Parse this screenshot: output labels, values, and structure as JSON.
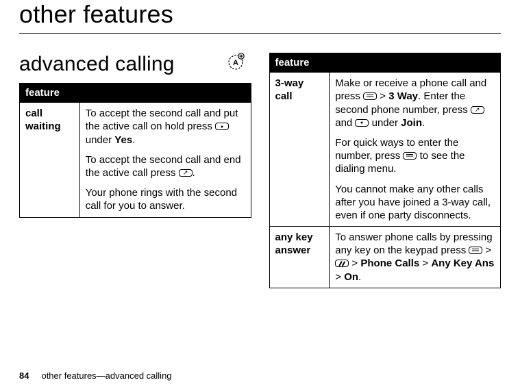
{
  "title": "other features",
  "section_title": "advanced calling",
  "left_table": {
    "header": "feature",
    "rows": [
      {
        "name": "call waiting",
        "paras": [
          {
            "pre": "To accept the second call and put the active call on hold press ",
            "icon": "dot",
            "post": " under ",
            "bold": "Yes",
            "tail": "."
          },
          {
            "pre": "To accept the second call and end the active call press ",
            "icon": "send",
            "post": ".",
            "bold": "",
            "tail": ""
          },
          {
            "pre": "Your phone rings with the second call for you to answer.",
            "icon": "",
            "post": "",
            "bold": "",
            "tail": ""
          }
        ]
      }
    ]
  },
  "right_table": {
    "header": "feature",
    "rows": [
      {
        "name": "3-way call",
        "p1": {
          "a": "Make or receive a phone call and press ",
          "b": " > ",
          "bold1": "3 Way",
          "c": ". Enter the second phone number, press ",
          "d": " and ",
          "e": " under ",
          "bold2": "Join",
          "f": "."
        },
        "p2": {
          "a": "For quick ways to enter the number, press ",
          "b": " to see the dialing menu."
        },
        "p3": "You cannot make any other calls after you have joined a 3-way call, even if one party disconnects."
      },
      {
        "name": "any key answer",
        "p1": {
          "a": "To answer phone calls by pressing any key on the keypad press ",
          "b": " > ",
          "c": " > ",
          "bold1": "Phone Calls",
          "d": " > ",
          "bold2": "Any Key Ans",
          "e": " > ",
          "bold3": "On",
          "f": "."
        }
      }
    ]
  },
  "footer": {
    "page": "84",
    "text": "other features—advanced calling"
  }
}
